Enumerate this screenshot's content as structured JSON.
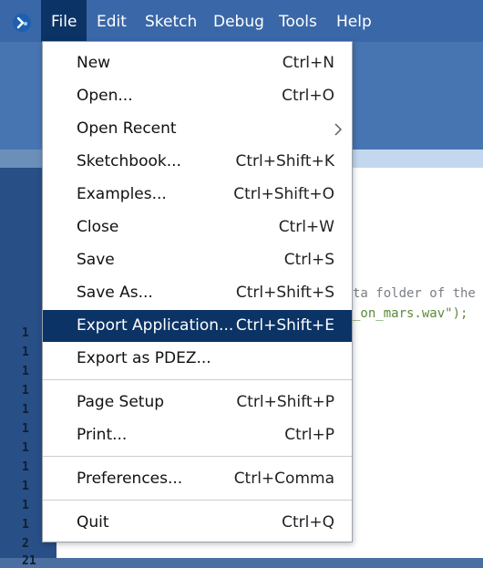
{
  "menubar": {
    "items": [
      {
        "label": "File",
        "active": true
      },
      {
        "label": "Edit",
        "active": false
      },
      {
        "label": "Sketch",
        "active": false
      },
      {
        "label": "Debug",
        "active": false
      },
      {
        "label": "Tools",
        "active": false
      },
      {
        "label": "Help",
        "active": false
      }
    ]
  },
  "file_menu": {
    "items": [
      {
        "label": "New",
        "shortcut": "Ctrl+N"
      },
      {
        "label": "Open...",
        "shortcut": "Ctrl+O"
      },
      {
        "label": "Open Recent",
        "shortcut": "",
        "submenu": true
      },
      {
        "label": "Sketchbook...",
        "shortcut": "Ctrl+Shift+K"
      },
      {
        "label": "Examples...",
        "shortcut": "Ctrl+Shift+O"
      },
      {
        "label": "Close",
        "shortcut": "Ctrl+W"
      },
      {
        "label": "Save",
        "shortcut": "Ctrl+S"
      },
      {
        "label": "Save As...",
        "shortcut": "Ctrl+Shift+S"
      },
      {
        "label": "Export Application...",
        "shortcut": "Ctrl+Shift+E",
        "highlighted": true
      },
      {
        "label": "Export as PDEZ...",
        "shortcut": ""
      },
      {
        "label": "Page Setup",
        "shortcut": "Ctrl+Shift+P"
      },
      {
        "label": "Print...",
        "shortcut": "Ctrl+P"
      },
      {
        "label": "Preferences...",
        "shortcut": "Ctrl+Comma"
      },
      {
        "label": "Quit",
        "shortcut": "Ctrl+Q"
      }
    ]
  },
  "editor": {
    "code_comment_fragment": "ta folder of the",
    "code_string_fragment": "_on_mars.wav\");",
    "line_numbers": [
      "1",
      "1",
      "1",
      "1",
      "1",
      "1",
      "1",
      "1",
      "1",
      "1",
      "1",
      "2",
      "21"
    ]
  },
  "colors": {
    "menubar_bg": "#3a67a8",
    "highlight": "#0b3365",
    "gutter": "#294f87"
  }
}
